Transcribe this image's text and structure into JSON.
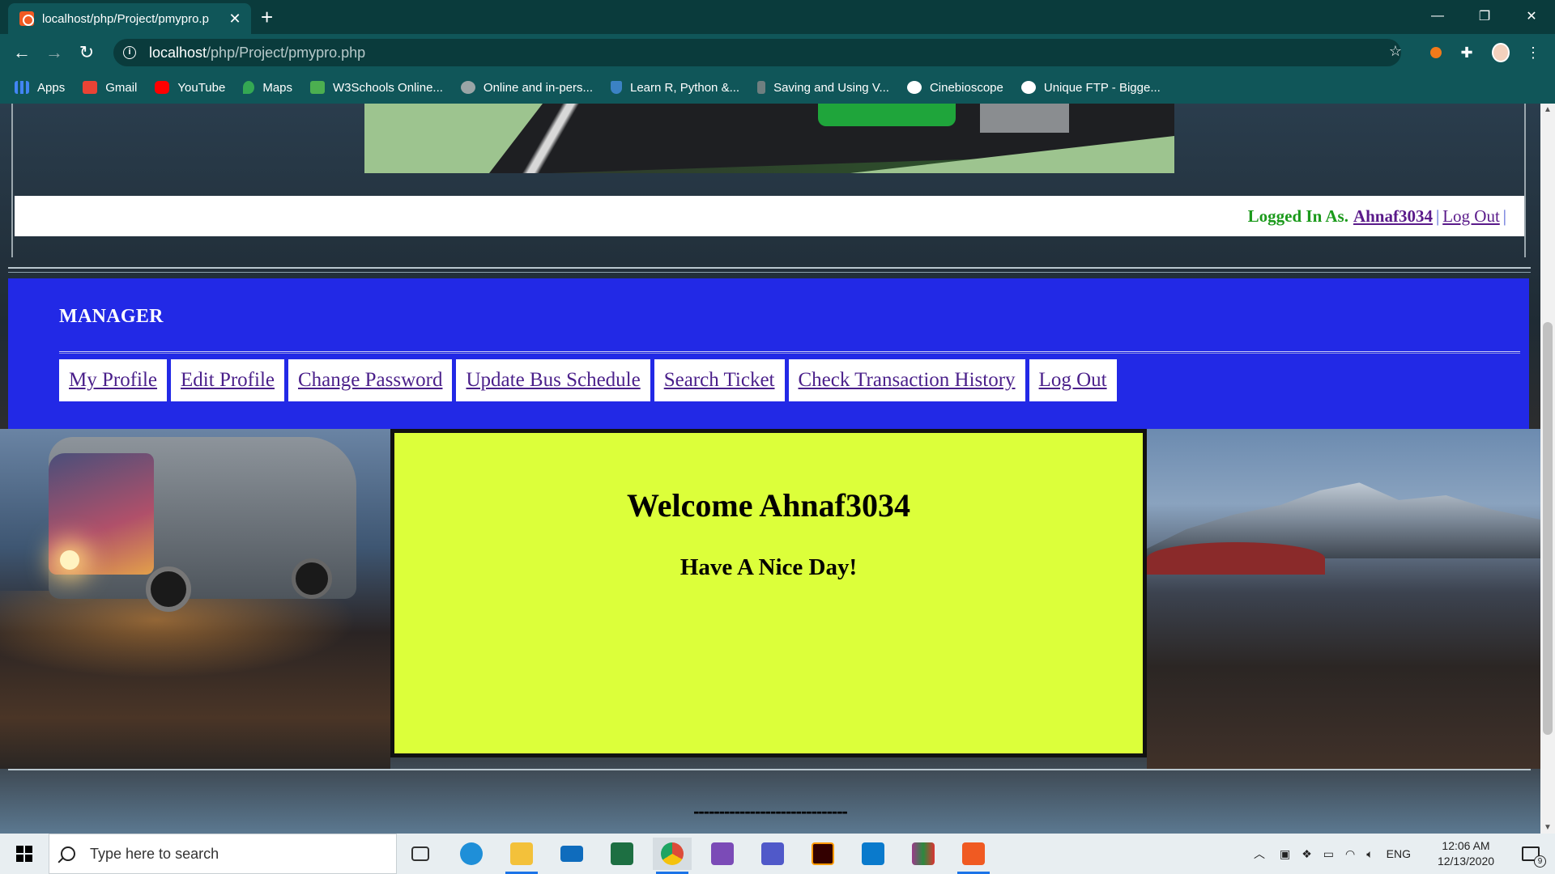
{
  "browser": {
    "tab_title": "localhost/php/Project/pmypro.p",
    "tab_close": "✕",
    "new_tab": "+",
    "url_host": "localhost",
    "url_path": "/php/Project/pmypro.php",
    "window_controls": [
      "—",
      "❐",
      "✕"
    ]
  },
  "bookmarks": [
    {
      "label": "Apps",
      "icon": "apps-grid-icon",
      "color": "#4285f4"
    },
    {
      "label": "Gmail",
      "icon": "gmail-icon",
      "color": "#ea4335"
    },
    {
      "label": "YouTube",
      "icon": "youtube-icon",
      "color": "#ff0000"
    },
    {
      "label": "Maps",
      "icon": "maps-icon",
      "color": "#34a853"
    },
    {
      "label": "W3Schools Online...",
      "icon": "w3schools-icon",
      "color": "#4caf50"
    },
    {
      "label": "Online and in-pers...",
      "icon": "globe-icon",
      "color": "#aaaaaa"
    },
    {
      "label": "Learn R, Python &...",
      "icon": "shield-icon",
      "color": "#3b82c4"
    },
    {
      "label": "Saving and Using V...",
      "icon": "feather-icon",
      "color": "#888888"
    },
    {
      "label": "Cinebioscope",
      "icon": "globe-icon",
      "color": "#ffffff"
    },
    {
      "label": "Unique FTP - Bigge...",
      "icon": "globe-icon",
      "color": "#ffffff"
    }
  ],
  "page": {
    "logged_in_label": "Logged In As.",
    "username": "Ahnaf3034",
    "logout_link": "Log Out",
    "separator": "|",
    "manager_title": "MANAGER",
    "nav": [
      "My Profile",
      "Edit Profile",
      "Change Password",
      "Update Bus Schedule",
      "Search Ticket",
      "Check Transaction History",
      "Log Out"
    ],
    "welcome_title": "Welcome Ahnaf3034",
    "welcome_sub": "Have A Nice Day!",
    "footer_dashes": "------------------------------"
  },
  "taskbar": {
    "search_placeholder": "Type here to search",
    "apps": [
      {
        "name": "task-view-icon",
        "color": "#333333"
      },
      {
        "name": "edge-icon",
        "color": "#1f8fd8"
      },
      {
        "name": "file-explorer-icon",
        "color": "#f3c13a"
      },
      {
        "name": "mail-icon",
        "color": "#0f6cbd"
      },
      {
        "name": "excel-icon",
        "color": "#1d6f42"
      },
      {
        "name": "chrome-icon",
        "color": "#dd4b39"
      },
      {
        "name": "visual-studio-icon",
        "color": "#7b4bb7"
      },
      {
        "name": "teams-icon",
        "color": "#5059c9"
      },
      {
        "name": "illustrator-icon",
        "color": "#330000"
      },
      {
        "name": "vscode-icon",
        "color": "#0a7acc"
      },
      {
        "name": "winrar-icon",
        "color": "#9b3a8a"
      },
      {
        "name": "xampp-icon",
        "color": "#f05a22"
      }
    ],
    "language": "ENG",
    "time": "12:06 AM",
    "date": "12/13/2020",
    "notification_count": "9"
  },
  "colors": {
    "manager_panel": "#2229e6",
    "welcome_box": "#dcff3a",
    "logged_in_green": "#1c9a1c",
    "link_purple": "#4a1f8a"
  }
}
